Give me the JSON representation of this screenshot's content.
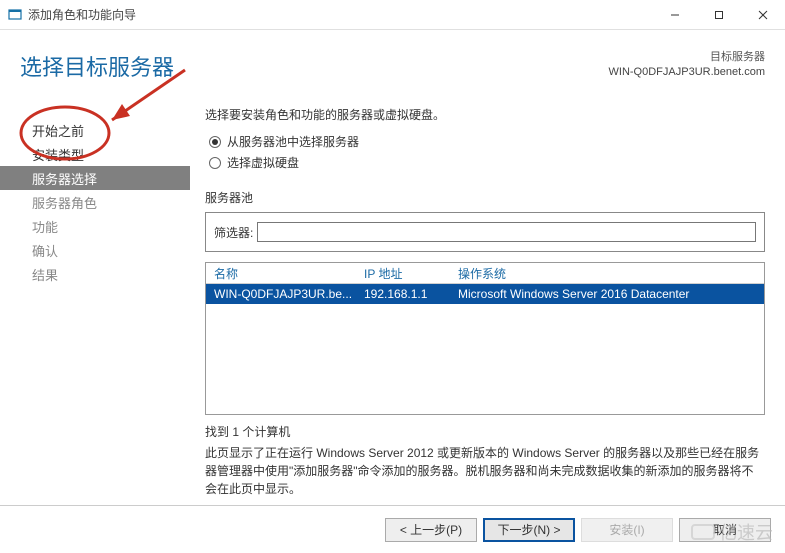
{
  "window": {
    "title": "添加角色和功能向导"
  },
  "header": {
    "page_title": "选择目标服务器",
    "dest_label": "目标服务器",
    "dest_host": "WIN-Q0DFJAJP3UR.benet.com"
  },
  "nav": {
    "items": [
      {
        "label": "开始之前",
        "enabled": true,
        "active": false
      },
      {
        "label": "安装类型",
        "enabled": true,
        "active": false
      },
      {
        "label": "服务器选择",
        "enabled": true,
        "active": true
      },
      {
        "label": "服务器角色",
        "enabled": false,
        "active": false
      },
      {
        "label": "功能",
        "enabled": false,
        "active": false
      },
      {
        "label": "确认",
        "enabled": false,
        "active": false
      },
      {
        "label": "结果",
        "enabled": false,
        "active": false
      }
    ]
  },
  "main": {
    "instruction": "选择要安装角色和功能的服务器或虚拟硬盘。",
    "radio_option1": "从服务器池中选择服务器",
    "radio_option2": "选择虚拟硬盘",
    "pool_label": "服务器池",
    "filter_label": "筛选器:",
    "filter_value": "",
    "table_headers": {
      "name": "名称",
      "ip": "IP 地址",
      "os": "操作系统"
    },
    "rows": [
      {
        "name": "WIN-Q0DFJAJP3UR.be...",
        "ip": "192.168.1.1",
        "os": "Microsoft Windows Server 2016 Datacenter"
      }
    ],
    "found_count": "找到 1 个计算机",
    "footnote": "此页显示了正在运行 Windows Server 2012 或更新版本的 Windows Server 的服务器以及那些已经在服务器管理器中使用\"添加服务器\"命令添加的服务器。脱机服务器和尚未完成数据收集的新添加的服务器将不会在此页中显示。"
  },
  "buttons": {
    "prev": "< 上一步(P)",
    "next": "下一步(N) >",
    "install": "安装(I)",
    "cancel": "取消"
  },
  "watermark": {
    "text": "亿速云"
  }
}
